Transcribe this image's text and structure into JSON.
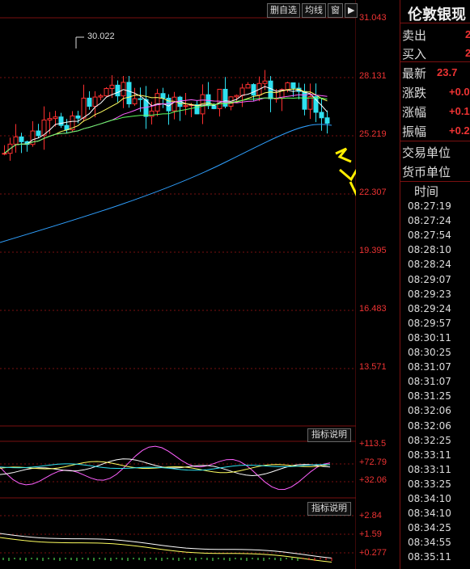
{
  "toolbar": {
    "delete_self_select": "删自选",
    "ma_line": "均线",
    "window": "窗",
    "arrow": "▶"
  },
  "price_axis": [
    "31.043",
    "28.131",
    "25.219",
    "22.307",
    "19.395",
    "16.483",
    "13.571"
  ],
  "high_label": "30.022",
  "indicator1": {
    "button": "指标说明",
    "axis": [
      "+113.5",
      "+72.79",
      "+32.06"
    ]
  },
  "indicator2": {
    "button": "指标说明",
    "axis": [
      "+2.84",
      "+1.59",
      "+0.277"
    ]
  },
  "quote": {
    "name": "伦敦银现",
    "sell_label": "卖出",
    "sell_value": "2",
    "buy_label": "买入",
    "buy_value": "2",
    "last_label": "最新",
    "last_value": "23.7",
    "change_label": "涨跌",
    "change_value": "+0.0",
    "pct_label": "涨幅",
    "pct_value": "+0.1",
    "amp_label": "振幅",
    "amp_value": "+0.2",
    "unit_label": "交易单位",
    "currency_label": "货币单位"
  },
  "time_header": "时间",
  "times": [
    "08:27:19",
    "08:27:24",
    "08:27:54",
    "08:28:10",
    "08:28:24",
    "08:29:07",
    "08:29:23",
    "08:29:24",
    "08:29:57",
    "08:30:11",
    "08:30:25",
    "08:31:07",
    "08:31:07",
    "08:31:25",
    "08:32:06",
    "08:32:06",
    "08:32:25",
    "08:33:11",
    "08:33:11",
    "08:33:25",
    "08:34:10",
    "08:34:10",
    "08:34:25",
    "08:34:55",
    "08:35:11"
  ],
  "colors": {
    "up": "#ff3030",
    "down": "#2fe0f0",
    "ma5": "#ffffff",
    "ma10": "#ffff60",
    "ma20": "#ff60ff",
    "ma60": "#60ff60",
    "ma120": "#2fa0ff",
    "arrow": "#ffee00",
    "axis": "#7a1010"
  }
}
